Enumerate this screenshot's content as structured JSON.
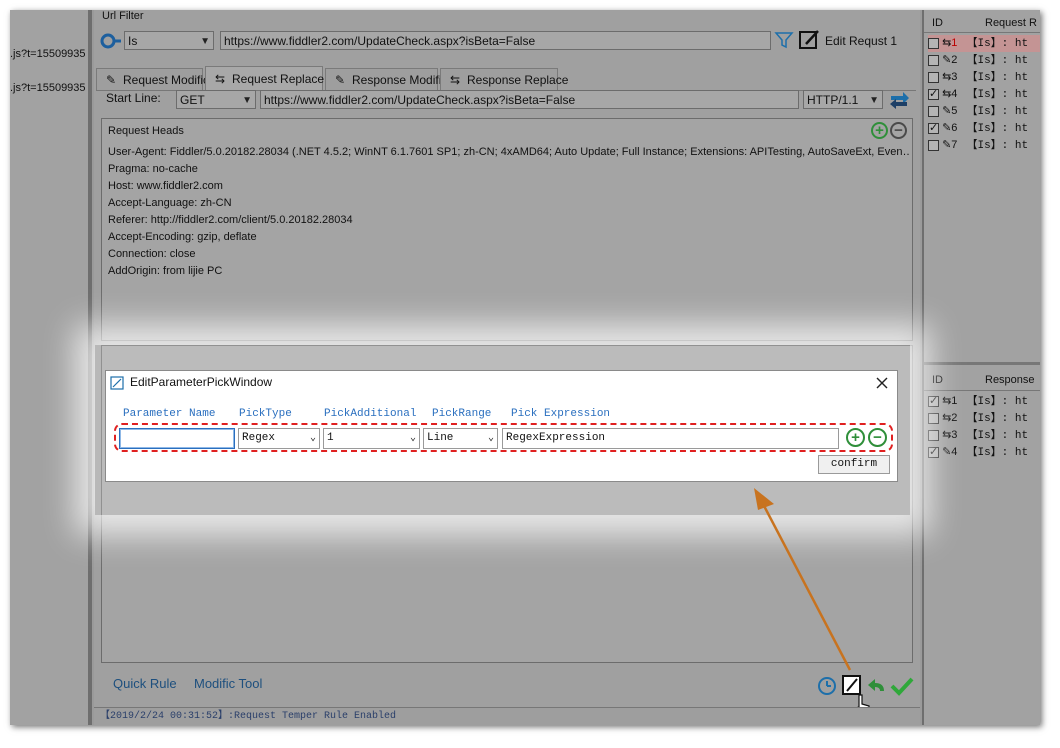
{
  "left_pane": {
    "urls": [
      ".js?t=15509935",
      ".js?t=15509935"
    ]
  },
  "url_filter": {
    "label": "Url Filter",
    "match_type": "Is",
    "url": "https://www.fiddler2.com/UpdateCheck.aspx?isBeta=False",
    "edit_label": "Edit Requst 1"
  },
  "tabs": [
    {
      "label": "Request Modific",
      "icon": "pencil-icon"
    },
    {
      "label": "Request Replace",
      "icon": "replace-icon"
    },
    {
      "label": "Response Modific",
      "icon": "pencil-icon"
    },
    {
      "label": "Response Replace",
      "icon": "replace-icon"
    }
  ],
  "start_line": {
    "label": "Start Line:",
    "method": "GET",
    "url": "https://www.fiddler2.com/UpdateCheck.aspx?isBeta=False",
    "version": "HTTP/1.1"
  },
  "request_heads": {
    "title": "Request Heads",
    "lines": [
      "User-Agent: Fiddler/5.0.20182.28034 (.NET 4.5.2; WinNT 6.1.7601 SP1; zh-CN; 4xAMD64; Auto Update; Full Instance; Extensions: APITesting, AutoSaveExt, Even…",
      "Pragma: no-cache",
      "Host: www.fiddler2.com",
      "Accept-Language: zh-CN",
      "Referer: http://fiddler2.com/client/5.0.20182.28034",
      "Accept-Encoding: gzip, deflate",
      "Connection: close",
      "AddOrigin: from lijie PC"
    ]
  },
  "dialog": {
    "title": "EditParameterPickWindow",
    "columns": [
      "Parameter Name",
      "PickType",
      "PickAdditional",
      "PickRange",
      "Pick Expression"
    ],
    "parameter_name": "",
    "pick_type": "Regex",
    "pick_additional": "1",
    "pick_range": "Line",
    "pick_expression": "RegexExpression",
    "confirm_label": "confirm"
  },
  "bottom_tabs": {
    "quick_rule": "Quick Rule",
    "modific_tool": "Modific Tool"
  },
  "log": "【2019/2/24 00:31:52】:Request Temper Rule Enabled",
  "request_list": {
    "headers": [
      "ID",
      "Request R"
    ],
    "rows": [
      {
        "id": "1",
        "checked": false,
        "icon": "replace-icon",
        "text": "【Is】: ht"
      },
      {
        "id": "2",
        "checked": false,
        "icon": "pencil-icon",
        "text": "【Is】: ht"
      },
      {
        "id": "3",
        "checked": false,
        "icon": "replace-icon",
        "text": "【Is】: ht"
      },
      {
        "id": "4",
        "checked": true,
        "icon": "replace-icon",
        "text": "【Is】: ht"
      },
      {
        "id": "5",
        "checked": false,
        "icon": "pencil-icon",
        "text": "【Is】: ht"
      },
      {
        "id": "6",
        "checked": true,
        "icon": "pencil-icon",
        "text": "【Is】: ht"
      },
      {
        "id": "7",
        "checked": false,
        "icon": "pencil-icon",
        "text": "【Is】: ht"
      }
    ]
  },
  "response_list": {
    "headers": [
      "ID",
      "Response"
    ],
    "rows": [
      {
        "id": "1",
        "checked": true,
        "icon": "replace-icon",
        "text": "【Is】: ht"
      },
      {
        "id": "2",
        "checked": false,
        "icon": "replace-icon",
        "text": "【Is】: ht"
      },
      {
        "id": "3",
        "checked": false,
        "icon": "replace-icon",
        "text": "【Is】: ht"
      },
      {
        "id": "4",
        "checked": true,
        "icon": "pencil-icon",
        "text": "【Is】: ht"
      }
    ]
  },
  "colors": {
    "accent_blue": "#2a6fbf",
    "green": "#2f8f3a",
    "highlight_red": "#e02020",
    "arrow": "#c8731f"
  }
}
